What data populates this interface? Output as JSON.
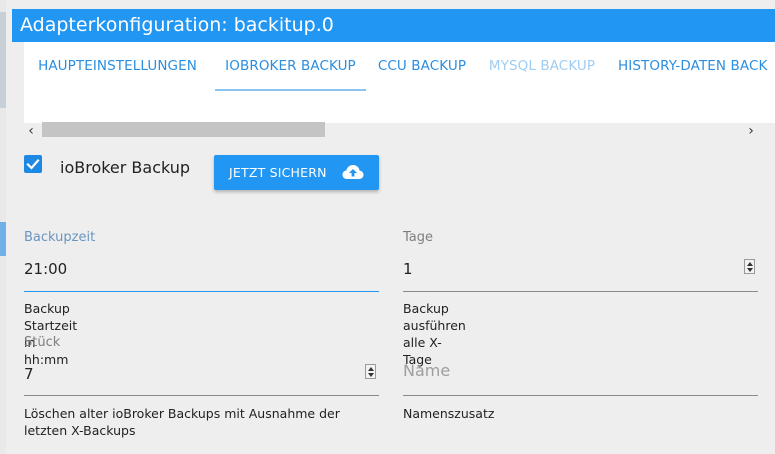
{
  "dialog": {
    "title": "Adapterkonfiguration: backitup.0"
  },
  "tabs": [
    {
      "label": "Haupteinstellungen",
      "state": "normal"
    },
    {
      "label": "ioBroker Backup",
      "state": "active"
    },
    {
      "label": "CCU Backup",
      "state": "normal"
    },
    {
      "label": "MySQL Backup",
      "state": "disabled"
    },
    {
      "label": "History-Daten Back",
      "state": "normal"
    }
  ],
  "scroll": {
    "left_icon": "chevron-left-icon",
    "right_icon": "chevron-right-icon",
    "left_glyph": "‹",
    "right_glyph": "›"
  },
  "iobroker_backup": {
    "checkbox_label": "ioBroker Backup",
    "checked": true,
    "button_label": "Jetzt sichern",
    "button_icon": "cloud-upload-icon"
  },
  "fields": {
    "backupzeit": {
      "label": "Backupzeit",
      "value": "21:00",
      "help": "Backup Startzeit in hh:mm"
    },
    "tage": {
      "label": "Tage",
      "value": "1",
      "help": "Backup ausführen alle X-Tage"
    },
    "stueck": {
      "label": "Stück",
      "value": "7",
      "help": "Löschen alter ioBroker Backups mit Ausnahme der letzten X-Backups"
    },
    "name": {
      "placeholder": "Name",
      "value": "",
      "help": "Namenszusatz"
    }
  },
  "colors": {
    "accent": "#2196f3",
    "tab_text": "#2b8ee0",
    "tab_disabled": "#9fcdf2",
    "background": "#eeeeee"
  }
}
